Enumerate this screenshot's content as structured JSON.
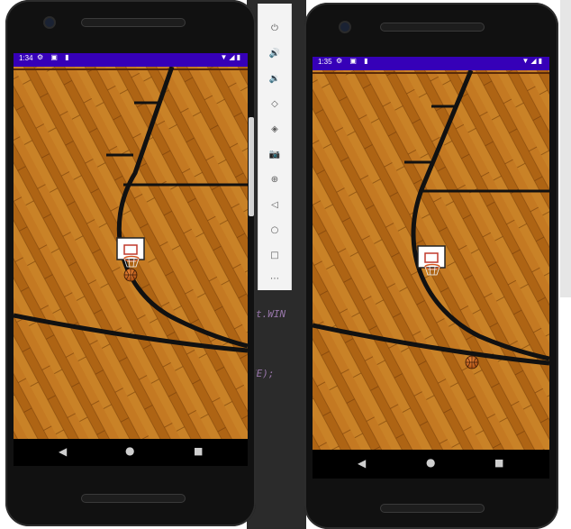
{
  "left_phone": {
    "status": {
      "time": "1:34",
      "left_icons": "⚙ ▣ ▮",
      "right_icons": "▼◢▮"
    },
    "nav": {
      "back": "◀",
      "home": "●",
      "recents": "■"
    }
  },
  "right_phone": {
    "status": {
      "time": "1:35",
      "left_icons": "⚙ ▣ ▮",
      "right_icons": "▼◢▮"
    },
    "nav": {
      "back": "◀",
      "home": "●",
      "recents": "■"
    }
  },
  "ide": {
    "line1": "t.WIN",
    "line2": "CE);"
  },
  "emulator_toolbar": {
    "icons": [
      "power-icon",
      "volume-up-icon",
      "volume-down-icon",
      "rotate-left-icon",
      "rotate-right-icon",
      "camera-icon",
      "zoom-icon",
      "back-icon",
      "home-icon",
      "overview-icon",
      "more-icon"
    ],
    "glyphs": [
      "⏻",
      "🔊",
      "🔉",
      "◇",
      "◈",
      "📷",
      "⊕",
      "◁",
      "○",
      "□",
      "⋯"
    ]
  },
  "colors": {
    "status_bar": "#3600b8",
    "court_wood": "#c8781c",
    "court_lines": "#111111"
  }
}
